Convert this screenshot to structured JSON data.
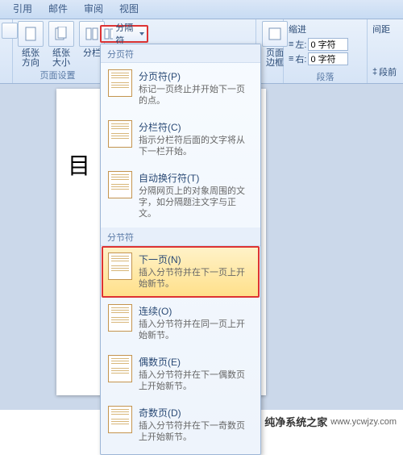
{
  "tabs": {
    "quote": "引用",
    "mail": "邮件",
    "review": "审阅",
    "view": "视图"
  },
  "ribbon": {
    "page_setup": {
      "orientation": "纸张方向",
      "size": "纸张大小",
      "columns": "分栏",
      "group": "页面设置"
    },
    "breaks_btn": "分隔符",
    "page_bg": {
      "page": "页面",
      "border": "边框"
    },
    "indent": {
      "group": "缩进",
      "left_label": "左:",
      "right_label": "右:",
      "left_val": "0 字符",
      "right_val": "0 字符"
    },
    "spacing": {
      "group": "间距",
      "before": "段前"
    },
    "para_group": "段落"
  },
  "doc": {
    "heading": "目"
  },
  "menu": {
    "hdr_page": "分页符",
    "hdr_section": "分节符",
    "items": {
      "page": {
        "t": "分页符(P)",
        "d": "标记一页终止并开始下一页的点。"
      },
      "col": {
        "t": "分栏符(C)",
        "d": "指示分栏符后面的文字将从下一栏开始。"
      },
      "wrap": {
        "t": "自动换行符(T)",
        "d": "分隔网页上的对象周围的文字，如分隔题注文字与正文。"
      },
      "next": {
        "t": "下一页(N)",
        "d": "插入分节符并在下一页上开始新节。"
      },
      "cont": {
        "t": "连续(O)",
        "d": "插入分节符并在同一页上开始新节。"
      },
      "even": {
        "t": "偶数页(E)",
        "d": "插入分节符并在下一偶数页上开始新节。"
      },
      "odd": {
        "t": "奇数页(D)",
        "d": "插入分节符并在下一奇数页上开始新节。"
      }
    }
  },
  "watermark": {
    "text": "纯净系统之家",
    "url": "www.ycwjzy.com"
  }
}
